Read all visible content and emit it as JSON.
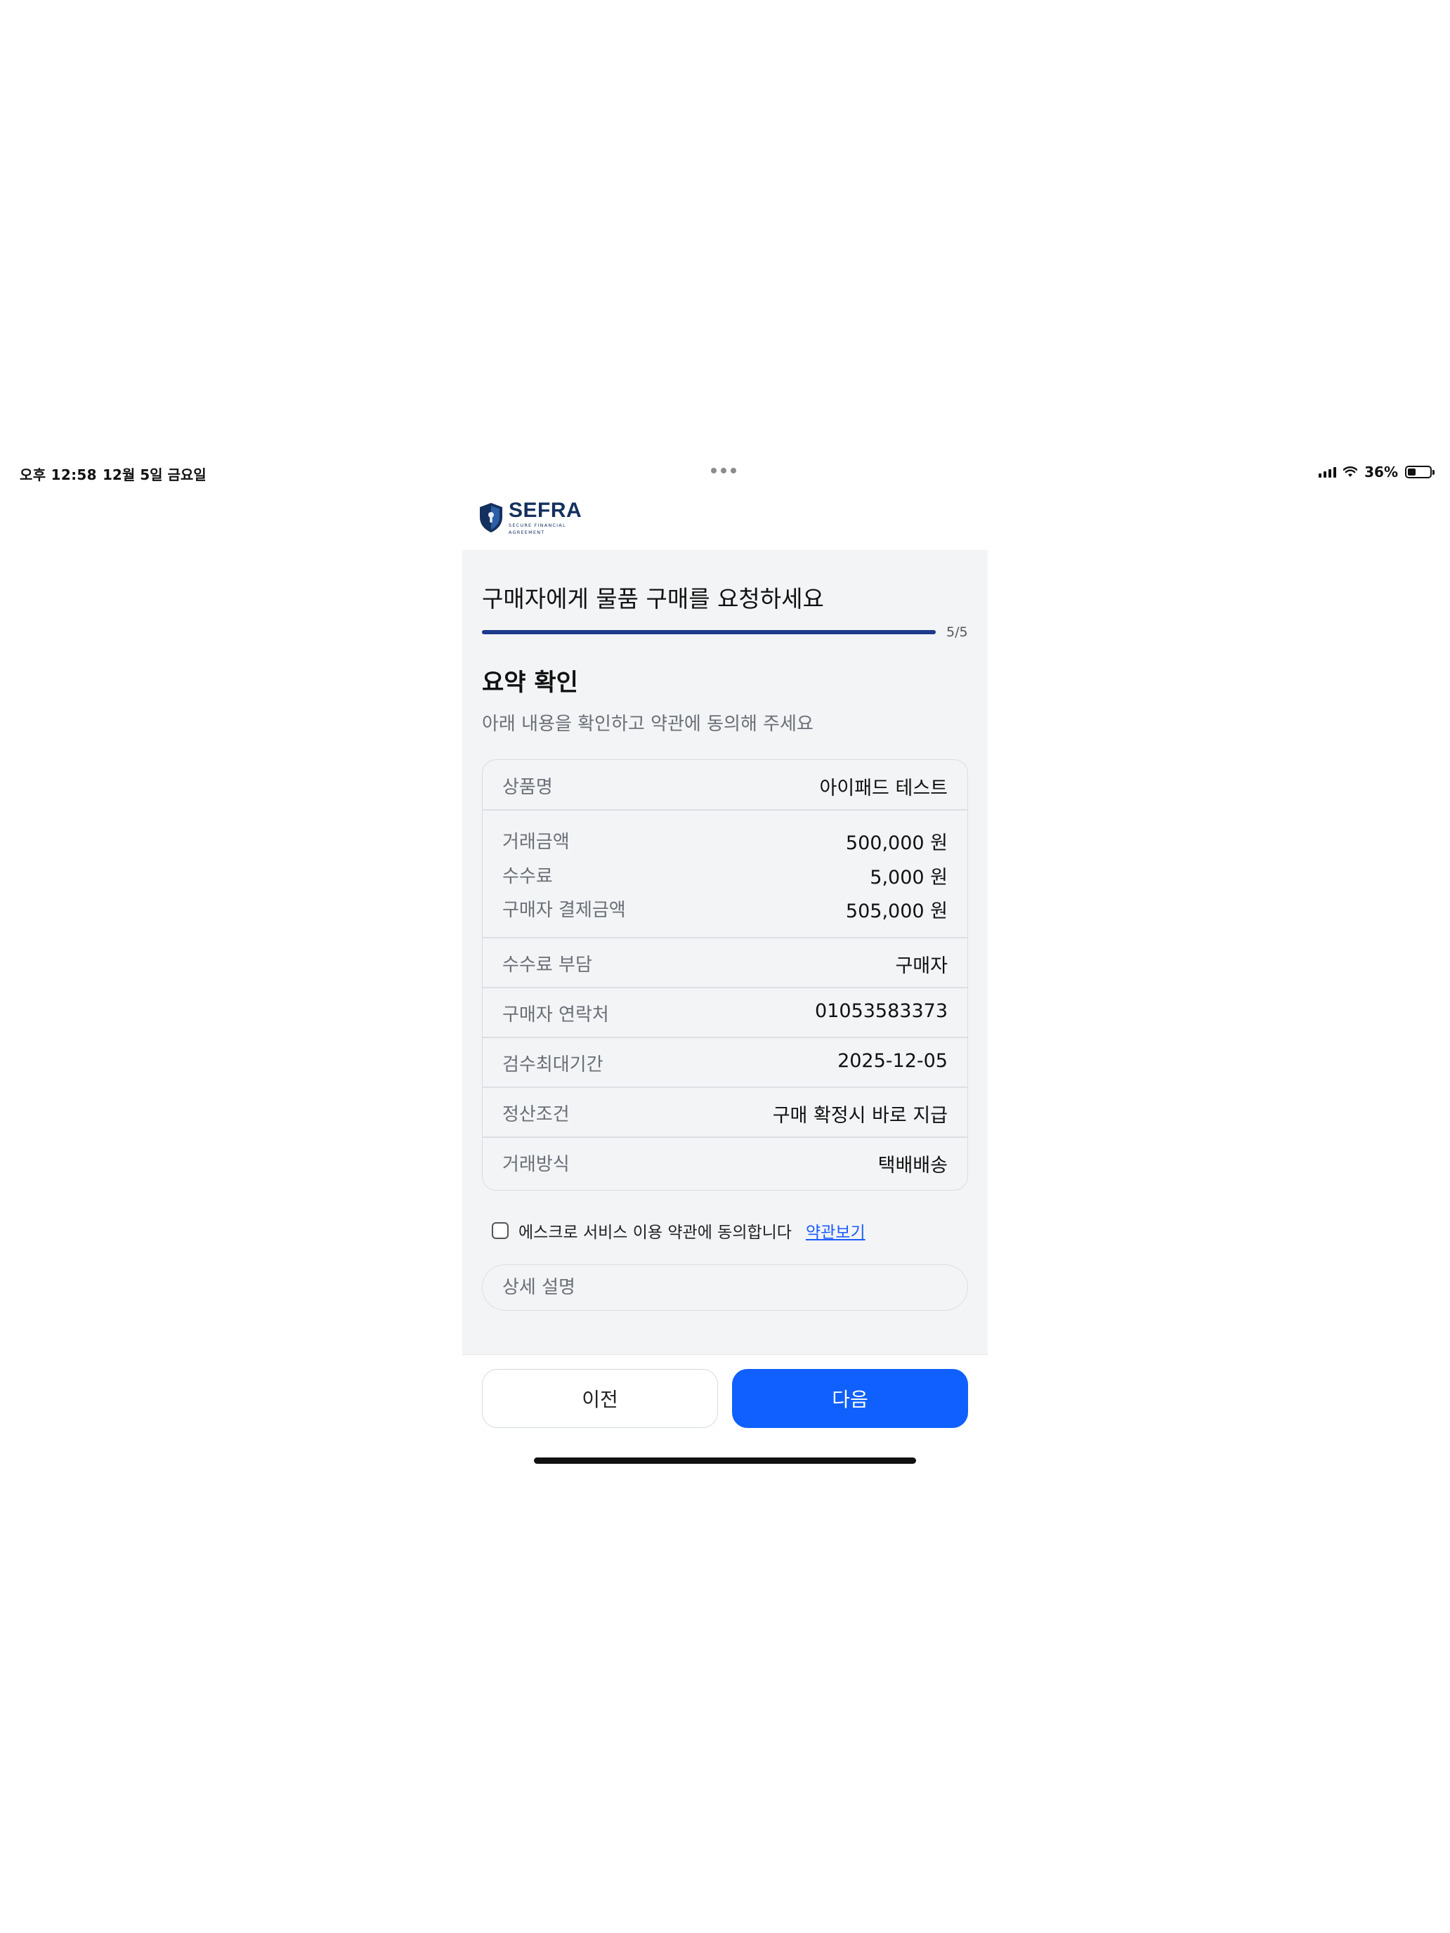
{
  "status_bar": {
    "time": "오후 12:58",
    "date": "12월 5일 금요일",
    "battery": "36%",
    "battery_level": 0.36
  },
  "logo": {
    "name": "SEFRA",
    "subtitle_line1": "SECURE FINANCIAL",
    "subtitle_line2": "AGREEMENT",
    "color": "#14305e"
  },
  "page": {
    "heading": "구매자에게 물품 구매를 요청하세요",
    "progress_text": "5/5",
    "progress_fraction": 1.0,
    "section_title": "요약 확인",
    "section_desc": "아래 내용을 확인하고 약관에 동의해 주세요"
  },
  "summary": {
    "product_label": "상품명",
    "product_value": "아이패드 테스트",
    "amount_label": "거래금액",
    "amount_value": "500,000 원",
    "fee_label": "수수료",
    "fee_value": "5,000 원",
    "payment_label": "구매자 결제금액",
    "payment_value": "505,000 원",
    "fee_bearer_label": "수수료 부담",
    "fee_bearer_value": "구매자",
    "contact_label": "구매자 연락처",
    "contact_value": "01053583373",
    "inspection_label": "검수최대기간",
    "inspection_value": "2025-12-05",
    "settlement_label": "정산조건",
    "settlement_value": "구매 확정시 바로 지급",
    "method_label": "거래방식",
    "method_value": "택배배송"
  },
  "agreement": {
    "text": "에스크로 서비스 이용 약관에 동의합니다",
    "link": "약관보기",
    "checked": false
  },
  "detail": {
    "placeholder": "상세 설명"
  },
  "buttons": {
    "prev": "이전",
    "next": "다음"
  },
  "colors": {
    "accent": "#1060ff",
    "progress": "#1d3a8a",
    "panel_bg": "#f2f4f6",
    "link": "#1a5cff"
  }
}
